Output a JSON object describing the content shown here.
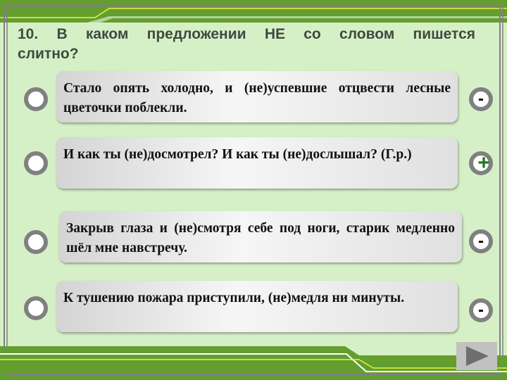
{
  "question": {
    "title": "10. В каком предложении НЕ со словом пишется слитно?"
  },
  "answers": [
    {
      "text": "Стало опять холодно, и (не)успевшие отцвести лесные цветочки поблекли.",
      "mark": "-",
      "correct": false
    },
    {
      "text": "И как ты (не)досмотрел? И как ты (не)дослышал? (Г.р.)",
      "mark": "+",
      "correct": true
    },
    {
      "text": "Закрыв глаза и (не)смотря себе под ноги, старик медленно шёл мне навстречу.",
      "mark": "-",
      "correct": false
    },
    {
      "text": "К тушению пожара приступили, (не)медля ни минуты.",
      "mark": "-",
      "correct": false
    }
  ],
  "navigation": {
    "next_icon": "play-triangle-icon"
  },
  "colors": {
    "background": "#d5f0c6",
    "frame_green": "#639e2e",
    "frame_gray": "#7f7f7f",
    "accent_yellow": "#e6f53a",
    "correct_mark": "#1a7a1a",
    "incorrect_mark": "#000000"
  }
}
